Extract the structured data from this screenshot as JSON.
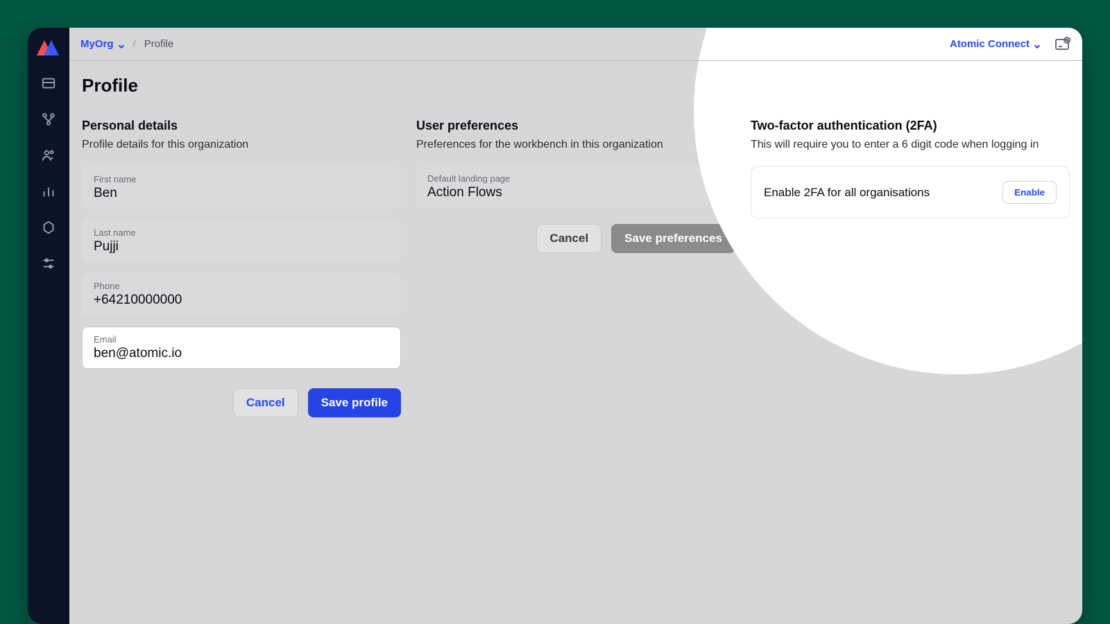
{
  "breadcrumb": {
    "org_label": "MyOrg",
    "page_label": "Profile"
  },
  "topbar": {
    "env_label": "Atomic Connect"
  },
  "page": {
    "title": "Profile"
  },
  "personal": {
    "heading": "Personal details",
    "subheading": "Profile details for this organization",
    "fields": {
      "first_name": {
        "label": "First name",
        "value": "Ben"
      },
      "last_name": {
        "label": "Last name",
        "value": "Pujji"
      },
      "phone": {
        "label": "Phone",
        "value": "+64210000000"
      },
      "email": {
        "label": "Email",
        "value": "ben@atomic.io"
      }
    },
    "cancel_label": "Cancel",
    "save_label": "Save profile"
  },
  "prefs": {
    "heading": "User preferences",
    "subheading": "Preferences for the workbench in this organization",
    "landing": {
      "label": "Default landing page",
      "value": "Action Flows"
    },
    "cancel_label": "Cancel",
    "save_label": "Save preferences"
  },
  "tfa": {
    "heading": "Two-factor authentication (2FA)",
    "subheading": "This will require you to enter a 6 digit code when logging in",
    "card_label": "Enable 2FA for all organisations",
    "enable_label": "Enable"
  }
}
